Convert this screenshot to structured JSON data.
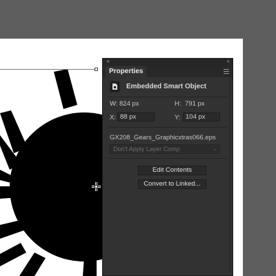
{
  "panel": {
    "title": "Properties",
    "close_icon": "×",
    "collapse_icon": "‹‹",
    "object_type": "Embedded Smart Object",
    "width_label": "W:",
    "width_value": "824 px",
    "height_label": "H:",
    "height_value": "791 px",
    "x_label": "X:",
    "x_value": "88 px",
    "y_label": "Y:",
    "y_value": "104 px",
    "filename": "GX208_Gears_Graphicxtras066.eps",
    "layer_comp": "Don't Apply Layer Comp",
    "edit_contents_label": "Edit Contents",
    "convert_label": "Convert to Linked..."
  },
  "colors": {
    "workspace": "#5e5e5e",
    "panel_bg": "#323232",
    "artwork": "#000000"
  }
}
